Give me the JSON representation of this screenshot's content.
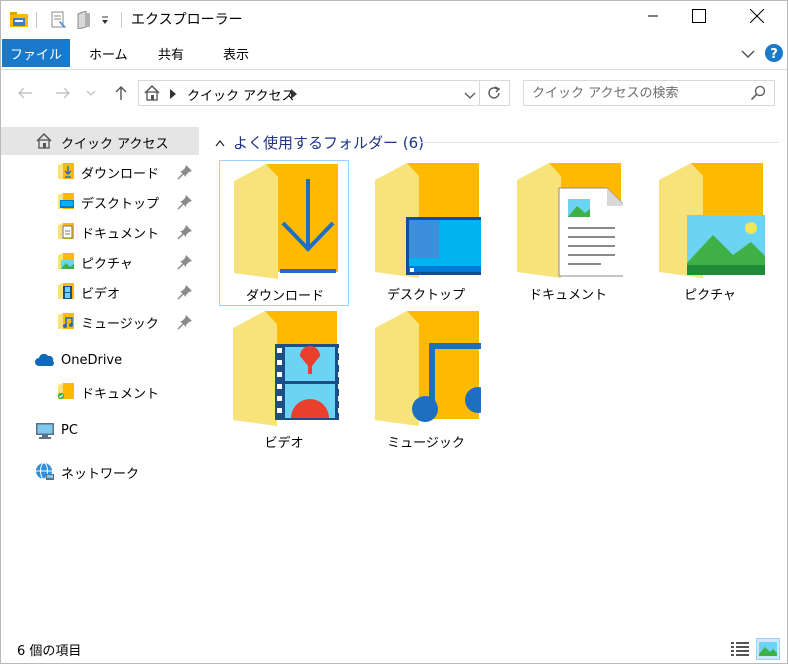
{
  "window": {
    "title": "エクスプローラー"
  },
  "ribbon": {
    "file_tab": "ファイル",
    "tabs": [
      "ホーム",
      "共有",
      "表示"
    ]
  },
  "address": {
    "path": "クイック アクセス"
  },
  "search": {
    "placeholder": "クイック アクセスの検索"
  },
  "navigation": {
    "quick_access": "クイック アクセス",
    "pinned": [
      {
        "label": "ダウンロード",
        "icon": "downloads-folder-icon"
      },
      {
        "label": "デスクトップ",
        "icon": "desktop-folder-icon"
      },
      {
        "label": "ドキュメント",
        "icon": "documents-folder-icon"
      },
      {
        "label": "ピクチャ",
        "icon": "pictures-folder-icon"
      },
      {
        "label": "ビデオ",
        "icon": "videos-folder-icon"
      },
      {
        "label": "ミュージック",
        "icon": "music-folder-icon"
      }
    ],
    "onedrive": "OneDrive",
    "onedrive_children": [
      {
        "label": "ドキュメント",
        "icon": "onedrive-documents-folder-icon"
      }
    ],
    "pc": "PC",
    "network": "ネットワーク"
  },
  "content": {
    "group_title": "よく使用するフォルダー (6)",
    "folders": [
      {
        "label": "ダウンロード",
        "icon": "downloads-folder-icon",
        "selected": true
      },
      {
        "label": "デスクトップ",
        "icon": "desktop-folder-icon"
      },
      {
        "label": "ドキュメント",
        "icon": "documents-folder-icon"
      },
      {
        "label": "ピクチャ",
        "icon": "pictures-folder-icon"
      },
      {
        "label": "ビデオ",
        "icon": "videos-folder-icon"
      },
      {
        "label": "ミュージック",
        "icon": "music-folder-icon"
      }
    ]
  },
  "status": {
    "item_count": "6 個の項目"
  },
  "colors": {
    "accent": "#1979ca",
    "folder_back": "#ffb900",
    "folder_front": "#f8e27a",
    "group_header": "#1e3287",
    "selection": "#cce8ff"
  }
}
